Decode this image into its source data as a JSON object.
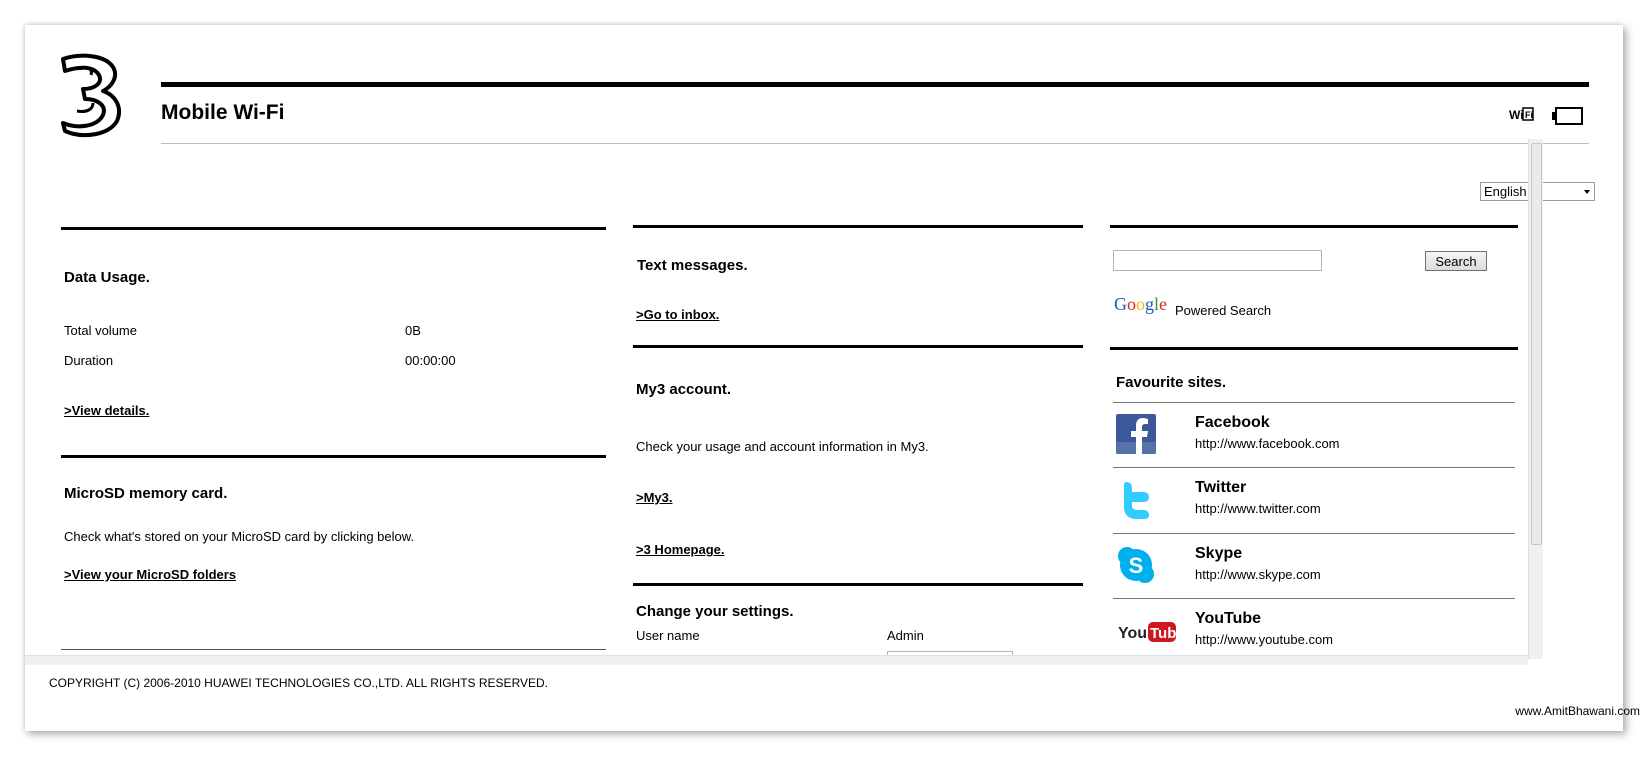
{
  "header": {
    "brand": "Mobile Wi-Fi",
    "logo_name": "three-logo"
  },
  "language": {
    "selected": "English"
  },
  "data_usage": {
    "title": "Data Usage.",
    "rows": [
      {
        "label": "Total volume",
        "value": "0B"
      },
      {
        "label": "Duration",
        "value": "00:00:00"
      }
    ],
    "link": ">View details."
  },
  "microsd": {
    "title": "MicroSD memory card.",
    "description": "Check what's stored on your MicroSD card by clicking below.",
    "link": ">View your MicroSD folders"
  },
  "text_messages": {
    "title": "Text messages.",
    "link": ">Go to inbox."
  },
  "my3": {
    "title": "My3 account.",
    "description": "Check your usage and account information in My3.",
    "link_my3": ">My3.",
    "link_home": ">3 Homepage."
  },
  "settings": {
    "title": "Change your settings.",
    "username_label": "User name",
    "username_value": "Admin"
  },
  "search": {
    "button": "Search",
    "powered": "Powered Search",
    "google": "Google"
  },
  "favourites": {
    "title": "Favourite sites.",
    "items": [
      {
        "name": "Facebook",
        "url": "http://www.facebook.com",
        "icon": "facebook-icon"
      },
      {
        "name": "Twitter",
        "url": "http://www.twitter.com",
        "icon": "twitter-icon"
      },
      {
        "name": "Skype",
        "url": "http://www.skype.com",
        "icon": "skype-icon"
      },
      {
        "name": "YouTube",
        "url": "http://www.youtube.com",
        "icon": "youtube-icon"
      }
    ]
  },
  "footer": {
    "copyright": "COPYRIGHT (C) 2006-2010 HUAWEI TECHNOLOGIES CO.,LTD. ALL RIGHTS RESERVED."
  },
  "watermark": "www.AmitBhawani.com",
  "colors": {
    "facebook": "#3b5998",
    "twitter": "#33ccff",
    "skype": "#00aff0",
    "youtube": "#cc181e"
  }
}
